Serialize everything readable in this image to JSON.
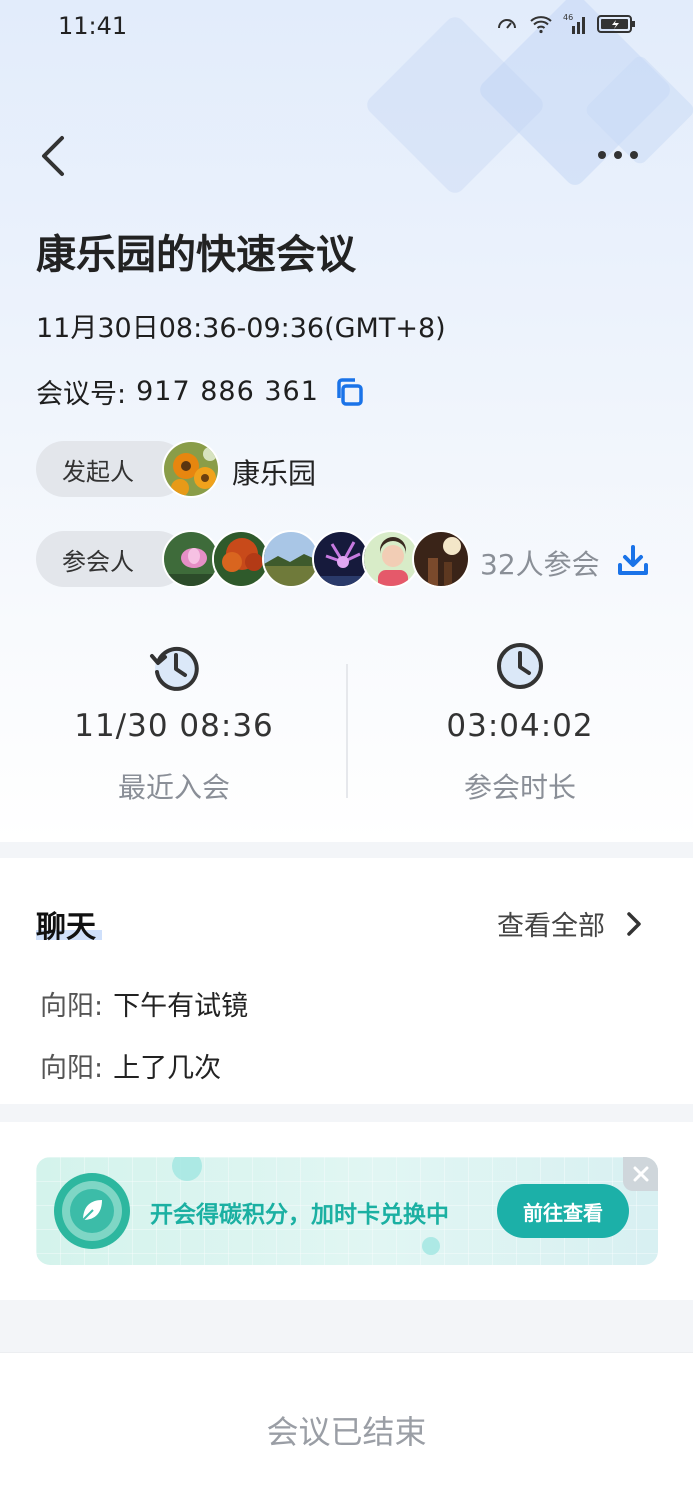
{
  "status_bar": {
    "time": "11:41",
    "network": "46"
  },
  "header": {
    "back": "back",
    "more": "more"
  },
  "meeting": {
    "title": "康乐园的快速会议",
    "time_range": "11月30日08:36-09:36(GMT+8)",
    "number_label": "会议号:",
    "number": "917 886 361"
  },
  "host": {
    "label": "发起人",
    "name": "康乐园"
  },
  "participants": {
    "label": "参会人",
    "count_text": "32人参会",
    "avatar_count": 6
  },
  "stats": {
    "last_join": {
      "value": "11/30 08:36",
      "label": "最近入会"
    },
    "duration": {
      "value": "03:04:02",
      "label": "参会时长"
    }
  },
  "chat": {
    "title": "聊天",
    "view_all": "查看全部",
    "messages": [
      {
        "sender": "向阳:",
        "text": "下午有试镜"
      },
      {
        "sender": "向阳:",
        "text": "上了几次"
      }
    ]
  },
  "promo": {
    "text": "开会得碳积分，加时卡兑换中",
    "button": "前往查看"
  },
  "footer": {
    "status": "会议已结束"
  },
  "colors": {
    "accent_blue": "#1a73e8",
    "teal": "#1cb0a8",
    "gray_text": "#8a8f97"
  }
}
